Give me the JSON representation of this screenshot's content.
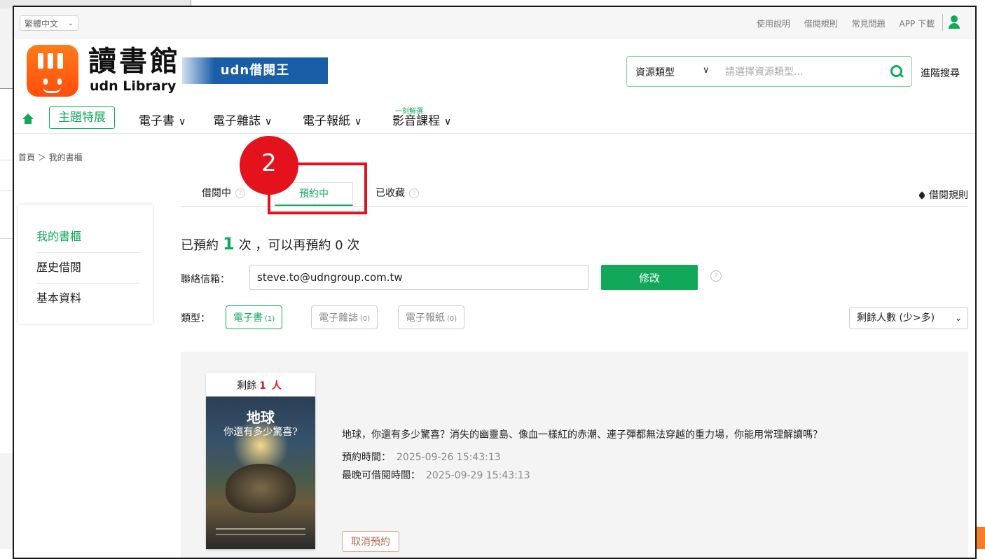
{
  "topbar": {
    "language": "繁體中文",
    "links": [
      "使用說明",
      "借閱規則",
      "常見問題",
      "APP 下載"
    ]
  },
  "logo": {
    "title": "讀書館",
    "subtitle": "udn Library",
    "partner": "udn借閱王"
  },
  "search": {
    "type_label": "資源類型",
    "placeholder": "請選擇資源類型...",
    "advanced": "進階搜尋"
  },
  "nav": {
    "theme": "主題特展",
    "items": [
      "電子書",
      "電子雜誌",
      "電子報紙",
      "影音課程"
    ],
    "tag": "一刻鮮選"
  },
  "breadcrumb": "首頁 ＞ 我的書櫃",
  "annotation": {
    "step": "2"
  },
  "tabs": {
    "borrowing": "借閱中",
    "reserved": "預約中",
    "favorites": "已收藏",
    "rules": "借閱規則"
  },
  "sidebar": {
    "items": [
      "我的書櫃",
      "歷史借閱",
      "基本資料"
    ]
  },
  "quota": {
    "prefix": "已預約",
    "count": "1",
    "suffix": "次 ，可以再預約 0 次"
  },
  "email": {
    "label": "聯絡信箱：",
    "value": "steve.to@udngroup.com.tw",
    "edit": "修改"
  },
  "types": {
    "label": "類型：",
    "items": [
      {
        "name": "電子書",
        "count": "(1)"
      },
      {
        "name": "電子雜誌",
        "count": "(0)"
      },
      {
        "name": "電子報紙",
        "count": "(0)"
      }
    ]
  },
  "sort": {
    "selected": "剩餘人數 (少>多)"
  },
  "reservation": {
    "remaining_prefix": "剩餘",
    "remaining_count": "1",
    "remaining_unit": "人",
    "cover_title1": "地球",
    "cover_title2": "你還有多少驚喜?",
    "title": "地球，你還有多少驚喜？消失的幽靈島、像血一樣紅的赤潮、連子彈都無法穿越的重力場，你能用常理解讀嗎？",
    "reserve_time_label": "預約時間：",
    "reserve_time": "2025-09-26 15:43:13",
    "deadline_label": "最晚可借閱時間：",
    "deadline": "2025-09-29 15:43:13",
    "cancel": "取消預約"
  },
  "colors": {
    "accent": "#12a85a",
    "highlight": "#e3121c",
    "logo": "#ff5a12"
  }
}
